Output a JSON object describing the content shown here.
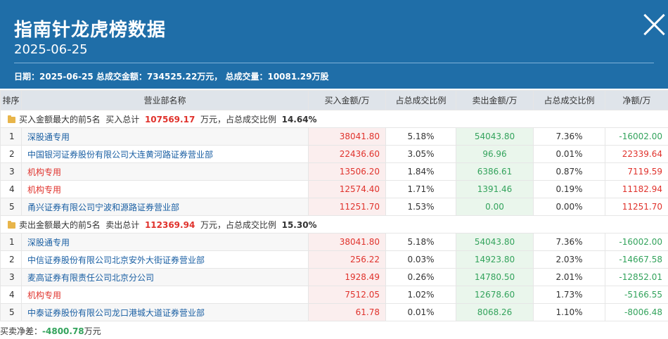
{
  "header": {
    "title": "指南针龙虎榜数据",
    "date": "2025-06-25",
    "summary": "日期：2025-06-25 总成交金额：734525.22万元， 总成交量：10081.29万股"
  },
  "columns": [
    "排序",
    "营业部名称",
    "买入金额/万",
    "占总成交比例",
    "卖出金额/万",
    "占总成交比例",
    "净额/万"
  ],
  "buy_section": {
    "label": "买入金额最大的前5名",
    "total_prefix": "买入总计",
    "total": "107569.17",
    "total_suffix": "万元，占总成交比例",
    "ratio": "14.64%",
    "rows": [
      {
        "rank": "1",
        "name": "深股通专用",
        "buy": "38041.80",
        "buy_ratio": "5.18%",
        "sell": "54043.80",
        "sell_ratio": "7.36%",
        "net": "-16002.00",
        "net_sign": "down",
        "name_color": "blue"
      },
      {
        "rank": "2",
        "name": "中国银河证券股份有限公司大连黄河路证券营业部",
        "buy": "22436.60",
        "buy_ratio": "3.05%",
        "sell": "96.96",
        "sell_ratio": "0.01%",
        "net": "22339.64",
        "net_sign": "up",
        "name_color": "blue"
      },
      {
        "rank": "3",
        "name": "机构专用",
        "buy": "13506.20",
        "buy_ratio": "1.84%",
        "sell": "6386.61",
        "sell_ratio": "0.87%",
        "net": "7119.59",
        "net_sign": "up",
        "name_color": "red"
      },
      {
        "rank": "4",
        "name": "机构专用",
        "buy": "12574.40",
        "buy_ratio": "1.71%",
        "sell": "1391.46",
        "sell_ratio": "0.19%",
        "net": "11182.94",
        "net_sign": "up",
        "name_color": "red"
      },
      {
        "rank": "5",
        "name": "甬兴证券有限公司宁波和源路证券营业部",
        "buy": "11251.70",
        "buy_ratio": "1.53%",
        "sell": "0.00",
        "sell_ratio": "0.00%",
        "net": "11251.70",
        "net_sign": "up",
        "name_color": "blue"
      }
    ]
  },
  "sell_section": {
    "label": "卖出金额最大的前5名",
    "total_prefix": "卖出总计",
    "total": "112369.94",
    "total_suffix": "万元，占总成交比例",
    "ratio": "15.30%",
    "rows": [
      {
        "rank": "1",
        "name": "深股通专用",
        "buy": "38041.80",
        "buy_ratio": "5.18%",
        "sell": "54043.80",
        "sell_ratio": "7.36%",
        "net": "-16002.00",
        "net_sign": "down",
        "name_color": "blue"
      },
      {
        "rank": "2",
        "name": "中信证券股份有限公司北京安外大街证券营业部",
        "buy": "256.22",
        "buy_ratio": "0.03%",
        "sell": "14923.80",
        "sell_ratio": "2.03%",
        "net": "-14667.58",
        "net_sign": "down",
        "name_color": "blue"
      },
      {
        "rank": "3",
        "name": "麦高证券有限责任公司北京分公司",
        "buy": "1928.49",
        "buy_ratio": "0.26%",
        "sell": "14780.50",
        "sell_ratio": "2.01%",
        "net": "-12852.01",
        "net_sign": "down",
        "name_color": "blue"
      },
      {
        "rank": "4",
        "name": "机构专用",
        "buy": "7512.05",
        "buy_ratio": "1.02%",
        "sell": "12678.60",
        "sell_ratio": "1.73%",
        "net": "-5166.55",
        "net_sign": "down",
        "name_color": "red"
      },
      {
        "rank": "5",
        "name": "中泰证券股份有限公司龙口港城大道证券营业部",
        "buy": "61.78",
        "buy_ratio": "0.01%",
        "sell": "8068.26",
        "sell_ratio": "1.10%",
        "net": "-8006.48",
        "net_sign": "down",
        "name_color": "blue"
      }
    ]
  },
  "footer": {
    "label": "买卖净差：",
    "value": "-4800.78",
    "unit": "万元"
  },
  "colors": {
    "header_bg": "#1f6ea8",
    "up": "#e0322c",
    "down": "#33a35c",
    "link": "#1a5fa3"
  },
  "icons": {
    "close": "close-icon",
    "section": "folder-icon"
  }
}
